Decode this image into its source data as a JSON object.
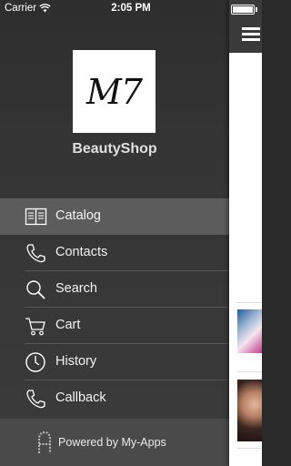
{
  "status_bar": {
    "carrier": "Carrier",
    "time": "2:05 PM"
  },
  "drawer": {
    "logo_text": "M7",
    "app_name": "BeautyShop",
    "items": [
      {
        "label": "Catalog",
        "icon": "book-icon",
        "active": true
      },
      {
        "label": "Contacts",
        "icon": "phone-icon"
      },
      {
        "label": "Search",
        "icon": "search-icon"
      },
      {
        "label": "Cart",
        "icon": "cart-icon"
      },
      {
        "label": "History",
        "icon": "clock-icon"
      },
      {
        "label": "Callback",
        "icon": "phone-icon"
      }
    ],
    "footer": {
      "label": "Powered by My-Apps",
      "icon": "myapps-logo-icon"
    }
  },
  "content": {
    "menu_icon": "hamburger-menu-icon"
  },
  "colors": {
    "drawer_bg": "#353535",
    "active_item": "#5c5c5c",
    "footer_bg": "#4a4a4a"
  }
}
